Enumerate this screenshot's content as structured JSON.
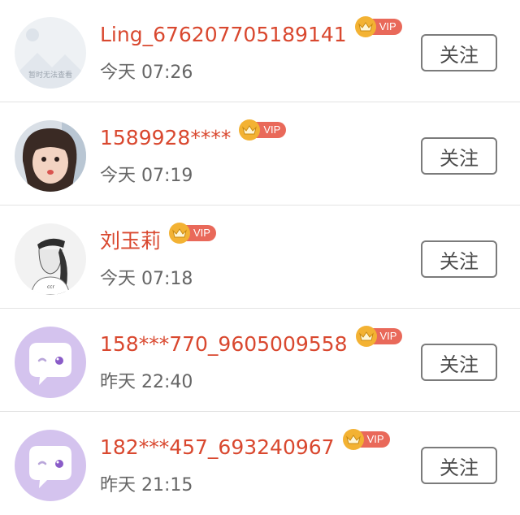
{
  "colors": {
    "name": "#d9482f",
    "time": "#666666",
    "vip_tag": "#e9695a",
    "crown": "#f3b233",
    "button_border": "#7b7b7b"
  },
  "rows": [
    {
      "name": "Ling_676207705189141",
      "vip": "VIP",
      "time": "今天 07:26",
      "follow": "关注",
      "avatar_icon": "placeholder-image-icon",
      "avatar_caption": "暂时无法查看"
    },
    {
      "name": "1589928****",
      "vip": "VIP",
      "time": "今天 07:19",
      "follow": "关注",
      "avatar_icon": "girl-photo-avatar"
    },
    {
      "name": "刘玉莉",
      "vip": "VIP",
      "time": "今天 07:18",
      "follow": "关注",
      "avatar_icon": "sketch-portrait-avatar"
    },
    {
      "name": "158***770_9605009558",
      "vip": "VIP",
      "time": "昨天 22:40",
      "follow": "关注",
      "avatar_icon": "chat-bubble-avatar-icon"
    },
    {
      "name": "182***457_693240967",
      "vip": "VIP",
      "time": "昨天 21:15",
      "follow": "关注",
      "avatar_icon": "chat-bubble-avatar-icon"
    }
  ]
}
